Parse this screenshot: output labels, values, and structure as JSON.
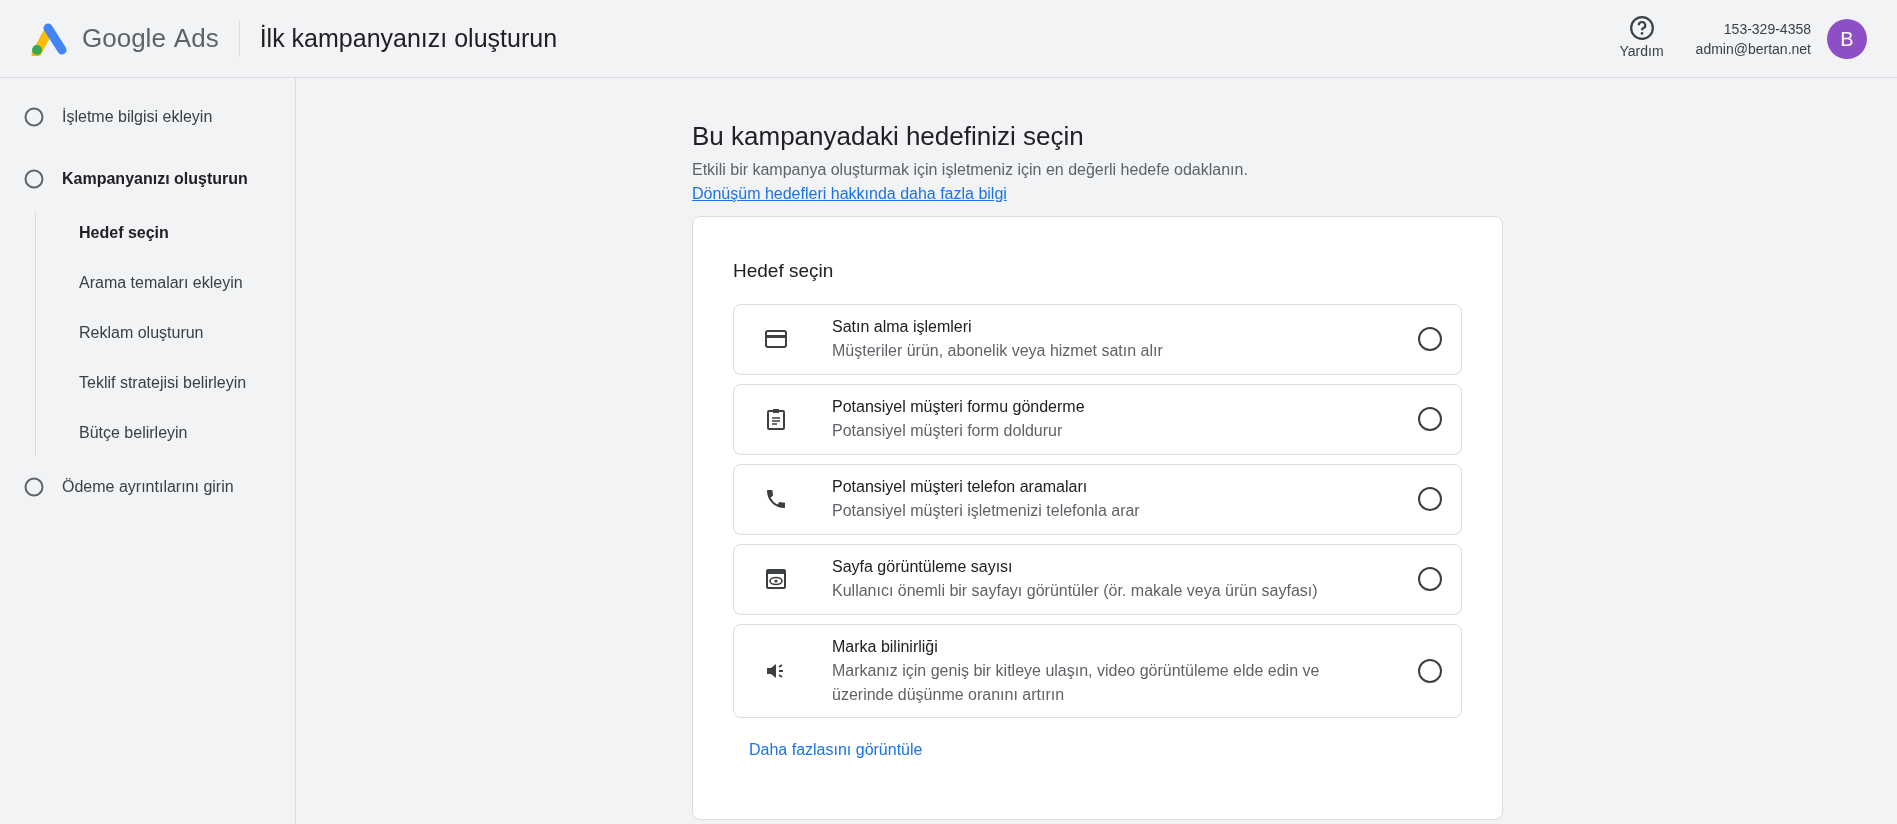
{
  "header": {
    "logo_text": "Google",
    "logo_product": "Ads",
    "title": "İlk kampanyanızı oluşturun",
    "help_label": "Yardım",
    "account_id": "153-329-4358",
    "account_email": "admin@bertan.net",
    "avatar_letter": "B"
  },
  "sidebar": {
    "steps": [
      {
        "label": "İşletme bilgisi ekleyin",
        "current": false
      },
      {
        "label": "Kampanyanızı oluşturun",
        "current": true,
        "children": [
          {
            "label": "Hedef seçin",
            "selected": true
          },
          {
            "label": "Arama temaları ekleyin",
            "selected": false
          },
          {
            "label": "Reklam oluşturun",
            "selected": false
          },
          {
            "label": "Teklif stratejisi belirleyin",
            "selected": false
          },
          {
            "label": "Bütçe belirleyin",
            "selected": false
          }
        ]
      },
      {
        "label": "Ödeme ayrıntılarını girin",
        "current": false
      }
    ]
  },
  "main": {
    "heading": "Bu kampanyadaki hedefinizi seçin",
    "description": "Etkili bir kampanya oluşturmak için işletmeniz için en değerli hedefe odaklanın.",
    "description_link": "Dönüşüm hedefleri hakkında daha fazla bilgi",
    "card": {
      "title": "Hedef seçin",
      "options": [
        {
          "kind": "card",
          "title": "Satın alma işlemleri",
          "subtitle": "Müşteriler ürün, abonelik veya hizmet satın alır",
          "selected": false
        },
        {
          "kind": "clipboard",
          "title": "Potansiyel müşteri formu gönderme",
          "subtitle": "Potansiyel müşteri form doldurur",
          "selected": false
        },
        {
          "kind": "phone",
          "title": "Potansiyel müşteri telefon aramaları",
          "subtitle": "Potansiyel müşteri işletmenizi telefonla arar",
          "selected": false
        },
        {
          "kind": "eye",
          "title": "Sayfa görüntüleme sayısı",
          "subtitle": "Kullanıcı önemli bir sayfayı görüntüler (ör. makale veya ürün sayfası)",
          "selected": false
        },
        {
          "kind": "speaker",
          "title": "Marka bilinirliği",
          "subtitle": "Markanız için geniş bir kitleye ulaşın, video görüntüleme elde edin ve üzerinde düşünme oranını artırın",
          "selected": false
        }
      ],
      "more_link": "Daha fazlasını görüntüle"
    }
  }
}
